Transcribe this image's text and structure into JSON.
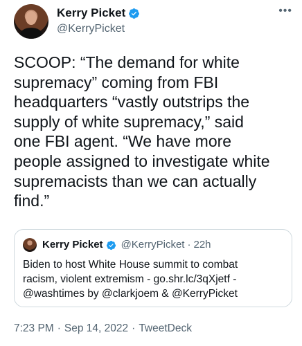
{
  "author": {
    "name": "Kerry Picket",
    "handle": "@KerryPicket",
    "verified": true
  },
  "menu": {
    "more_label": "•••"
  },
  "tweet": {
    "text": "SCOOP: “The demand for white\nsupremacy” coming from FBI\nheadquarters “vastly outstrips the\nsupply of white supremacy,” said\none FBI agent. “We have more\npeople assigned to investigate white\nsupremacists than we can actually\nfind.”"
  },
  "quoted_tweet": {
    "author_name": "Kerry Picket",
    "author_handle": "@KerryPicket",
    "separator": "·",
    "time": "22h",
    "text": "Biden to host White House summit to combat\nracism, violent extremism - go.shr.lc/3qXjetf -\n@washtimes  by @clarkjoem & @KerryPicket"
  },
  "footer": {
    "time": "7:23 PM",
    "separator1": "·",
    "date": "Sep 14, 2022",
    "separator2": "·",
    "source": "TweetDeck"
  },
  "colors": {
    "verified_blue": "#1d9bf0",
    "secondary_text": "#536471",
    "primary_text": "#0f1419",
    "border": "#cfd9de"
  }
}
